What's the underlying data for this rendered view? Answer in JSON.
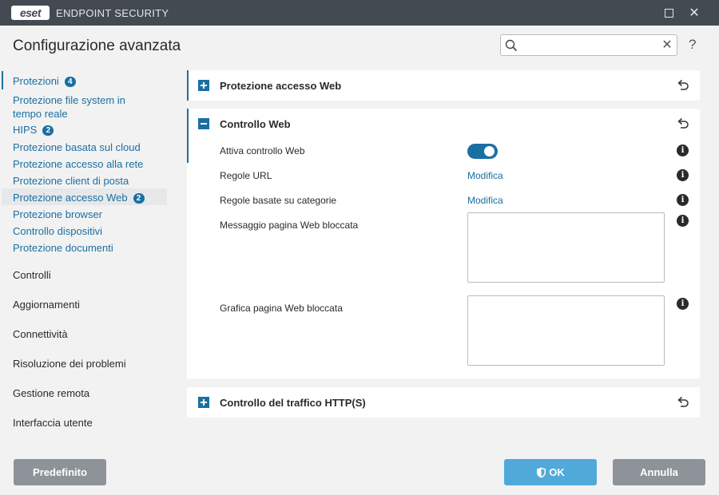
{
  "app": {
    "logo_text": "eset",
    "name": "ENDPOINT SECURITY",
    "maximize_icon": "maximize-icon",
    "close_icon": "close-icon",
    "close_glyph": "✕"
  },
  "header": {
    "title": "Configurazione avanzata",
    "search_placeholder": "",
    "search_value": "",
    "clear_glyph": "✕",
    "help_glyph": "?"
  },
  "sidebar": {
    "items": [
      {
        "label": "Protezioni",
        "badge": "4"
      },
      {
        "label": "Protezione file system in tempo reale"
      },
      {
        "label": "HIPS",
        "badge": "2"
      },
      {
        "label": "Protezione basata sul cloud"
      },
      {
        "label": "Protezione accesso alla rete"
      },
      {
        "label": "Protezione client di posta"
      },
      {
        "label": "Protezione accesso Web",
        "badge": "2",
        "selected": true
      },
      {
        "label": "Protezione browser"
      },
      {
        "label": "Controllo dispositivi"
      },
      {
        "label": "Protezione documenti"
      }
    ],
    "categories": [
      "Controlli",
      "Aggiornamenti",
      "Connettività",
      "Risoluzione dei problemi",
      "Gestione remota",
      "Interfaccia utente"
    ]
  },
  "panels": {
    "web_access": {
      "title": "Protezione accesso Web",
      "expanded": false
    },
    "web_control": {
      "title": "Controllo Web",
      "expanded": true,
      "enable_label": "Attiva controllo Web",
      "enable_value": true,
      "url_rules_label": "Regole URL",
      "url_rules_link": "Modifica",
      "category_rules_label": "Regole basate su categorie",
      "category_rules_link": "Modifica",
      "blocked_message_label": "Messaggio pagina Web bloccata",
      "blocked_message_value": "",
      "blocked_graphic_label": "Grafica pagina Web bloccata",
      "blocked_graphic_value": ""
    },
    "http_traffic": {
      "title": "Controllo del traffico HTTP(S)",
      "expanded": false
    }
  },
  "footer": {
    "default_label": "Predefinito",
    "ok_label": "OK",
    "cancel_label": "Annulla"
  },
  "colors": {
    "accent": "#1a6fa2",
    "titlebar": "#434a52",
    "ok_button": "#51a9d9",
    "gray_button": "#8e9399"
  }
}
